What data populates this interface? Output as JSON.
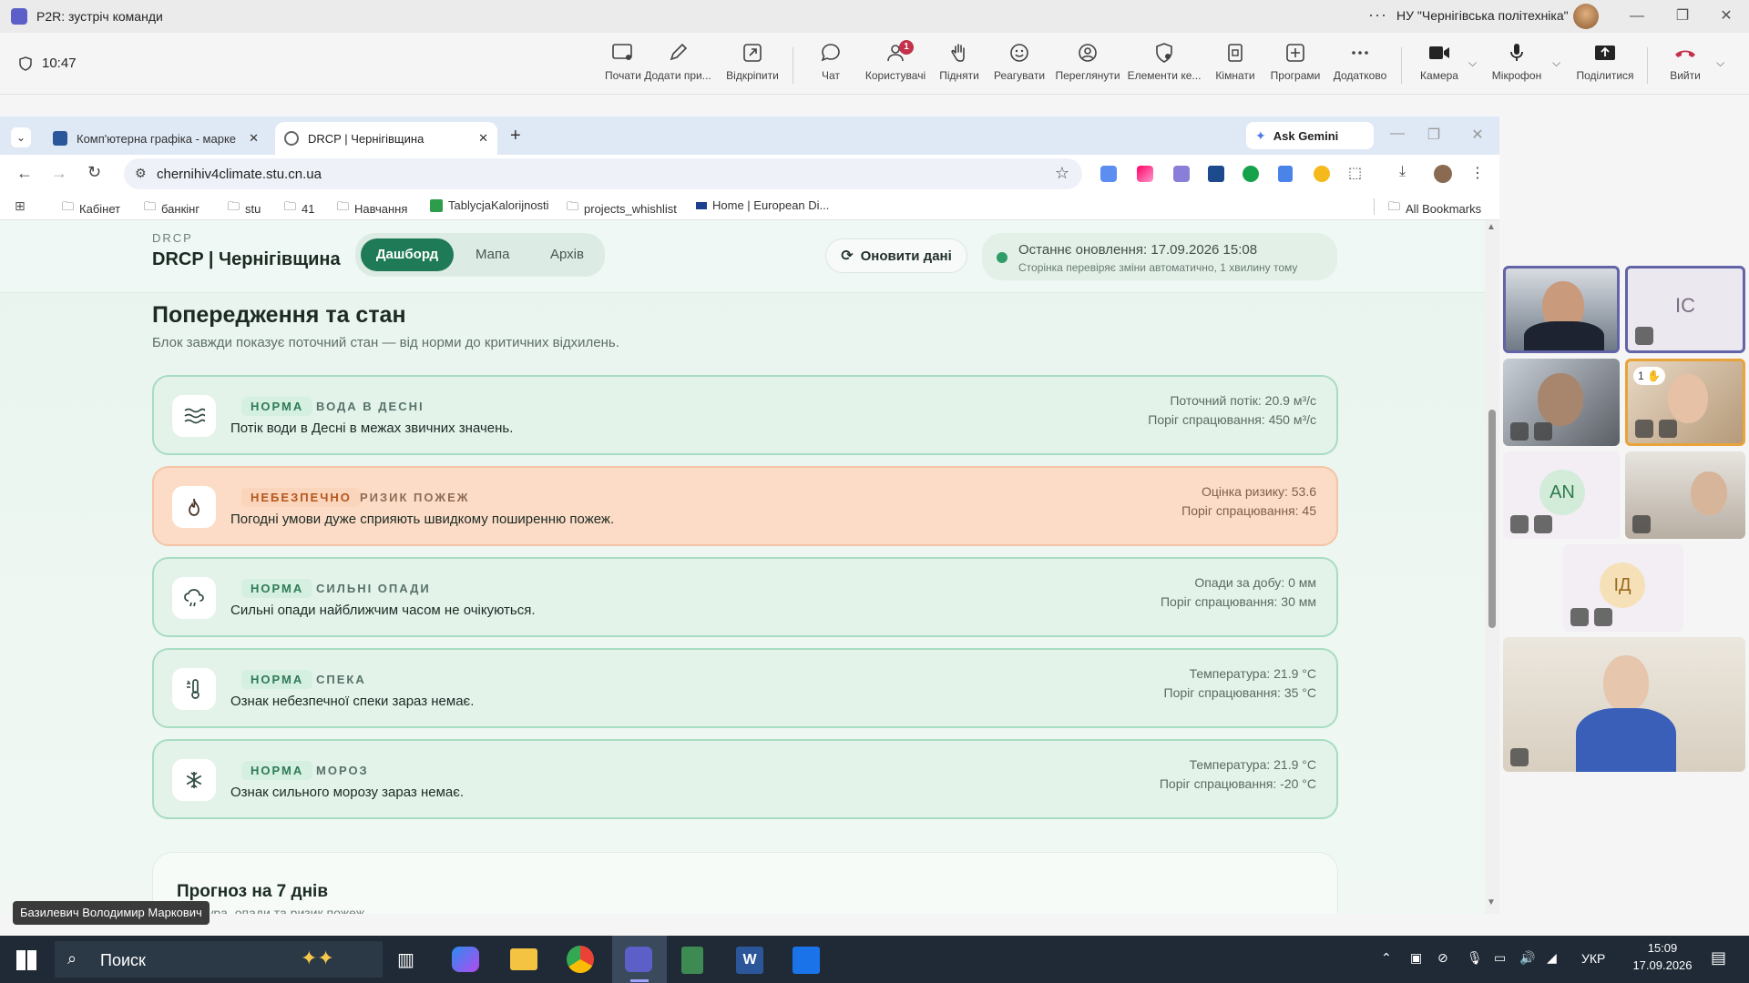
{
  "teams": {
    "window_title": "P2R: зустріч команди",
    "org": "НУ \"Чернігівська політехніка\"",
    "timer": "10:47",
    "toolbar": [
      {
        "label": "Почати",
        "icon": "screen-share-icon"
      },
      {
        "label": "Додати при...",
        "icon": "pen-icon"
      },
      {
        "label": "Відкріпити",
        "icon": "pop-out-icon"
      },
      {
        "label": "Чат",
        "icon": "chat-icon"
      },
      {
        "label": "Користувачі",
        "icon": "people-icon",
        "badge": "1"
      },
      {
        "label": "Підняти",
        "icon": "raise-hand-icon"
      },
      {
        "label": "Реагувати",
        "icon": "smiley-icon"
      },
      {
        "label": "Переглянути",
        "icon": "view-icon"
      },
      {
        "label": "Елементи ке...",
        "icon": "shield-gear-icon"
      },
      {
        "label": "Кімнати",
        "icon": "rooms-icon"
      },
      {
        "label": "Програми",
        "icon": "apps-plus-icon"
      },
      {
        "label": "Додатково",
        "icon": "more-icon"
      }
    ],
    "camera_label": "Камера",
    "mic_label": "Мікрофон",
    "share_label": "Поділитися",
    "leave_label": "Вийти",
    "presenter_name": "Базилевич Володимир Маркович",
    "participants": [
      {
        "initials": ""
      },
      {
        "initials": "IC"
      },
      {
        "initials": ""
      },
      {
        "initials": "",
        "hand": "1"
      },
      {
        "initials": "AN"
      },
      {
        "initials": ""
      },
      {
        "initials": "ІД"
      },
      {
        "initials": ""
      }
    ]
  },
  "browser": {
    "tabs": [
      {
        "title": "Комп'ютерна графіка - марке"
      },
      {
        "title": "DRCP | Чернігівщина"
      }
    ],
    "ask_gemini": "Ask Gemini",
    "url": "chernihiv4climate.stu.cn.ua",
    "bookmarks": [
      "Кабінет",
      "банкінг",
      "stu",
      "41",
      "Навчання",
      "TablycjaKalorijnosti",
      "projects_whishlist",
      "Home | European Di..."
    ],
    "all_bookmarks": "All Bookmarks"
  },
  "site": {
    "brand_small": "DRCP",
    "brand": "DRCP | Чернігівщина",
    "nav": [
      "Дашборд",
      "Мапа",
      "Архів"
    ],
    "refresh_label": "Оновити дані",
    "last_update": "Останнє оновлення: 17.09.2026 15:08",
    "auto_check": "Сторінка перевіряє зміни автоматично, 1 хвилину тому",
    "section_title": "Попередження та стан",
    "section_subtitle": "Блок завжди показує поточний стан — від норми до критичних відхилень.",
    "alerts": [
      {
        "level": "НОРМА",
        "category": "ВОДА В ДЕСНІ",
        "message": "Потік води в Десні в межах звичних значень.",
        "metric": "Поточний потік: 20.9 м³/с",
        "threshold": "Поріг спрацювання: 450 м³/с",
        "icon": "water-waves-icon"
      },
      {
        "level": "НЕБЕЗПЕЧНО",
        "category": "РИЗИК ПОЖЕЖ",
        "message": "Погодні умови дуже сприяють швидкому поширенню пожеж.",
        "metric": "Оцінка ризику: 53.6",
        "threshold": "Поріг спрацювання: 45",
        "icon": "fire-icon"
      },
      {
        "level": "НОРМА",
        "category": "СИЛЬНІ ОПАДИ",
        "message": "Сильні опади найближчим часом не очікуються.",
        "metric": "Опади за добу: 0 мм",
        "threshold": "Поріг спрацювання: 30 мм",
        "icon": "rain-cloud-icon"
      },
      {
        "level": "НОРМА",
        "category": "СПЕКА",
        "message": "Ознак небезпечної спеки зараз немає.",
        "metric": "Температура: 21.9 °C",
        "threshold": "Поріг спрацювання: 35 °C",
        "icon": "heat-thermometer-icon"
      },
      {
        "level": "НОРМА",
        "category": "МОРОЗ",
        "message": "Ознак сильного морозу зараз немає.",
        "metric": "Температура: 21.9 °C",
        "threshold": "Поріг спрацювання: -20 °C",
        "icon": "snowflake-icon"
      }
    ],
    "forecast_title": "Прогноз на 7 днів",
    "forecast_subtitle": "...ратура, опади та ризик пожеж"
  },
  "taskbar": {
    "search_placeholder": "Поиск",
    "language": "УКР",
    "time": "15:09",
    "date": "17.09.2026"
  }
}
